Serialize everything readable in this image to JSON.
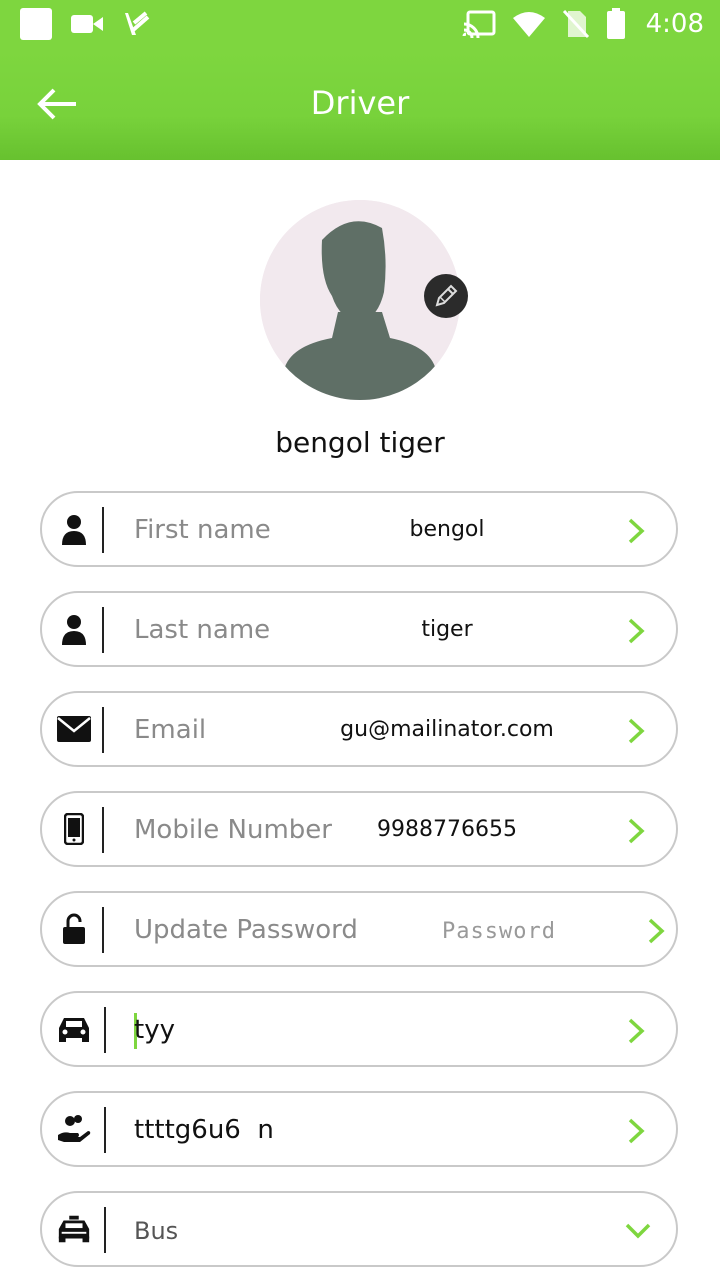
{
  "status_bar": {
    "time": "4:08"
  },
  "app_bar": {
    "title": "Driver"
  },
  "profile": {
    "display_name": "bengol tiger"
  },
  "fields": {
    "first_name": {
      "label": "First name",
      "value": "bengol"
    },
    "last_name": {
      "label": "Last name",
      "value": "tiger"
    },
    "email": {
      "label": "Email",
      "value": "gu@mailinator.com"
    },
    "mobile": {
      "label": "Mobile Number",
      "value": "9988776655"
    },
    "password": {
      "label": "Update Password",
      "placeholder": "Password"
    },
    "vehicle_model": {
      "value": "tyy"
    },
    "vehicle_number": {
      "value": "ttttg6u6  n"
    },
    "vehicle_type": {
      "value": "Bus"
    }
  },
  "colors": {
    "accent": "#7ed63f",
    "chevron": "#7ed63f",
    "border": "#c9c9c9"
  }
}
